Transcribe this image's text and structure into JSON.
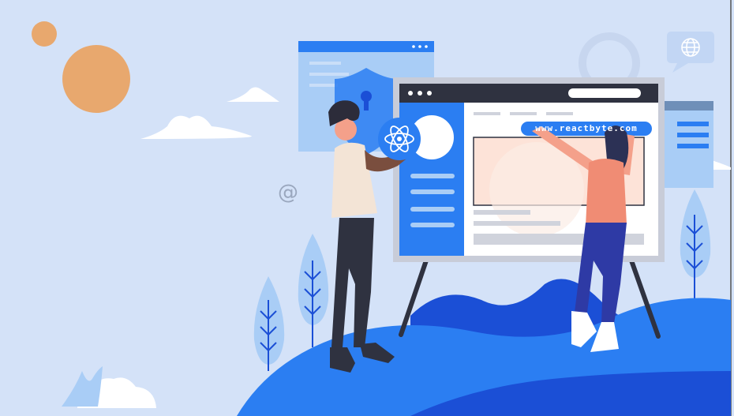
{
  "illustration": {
    "url_label": "www.reactbyte.com",
    "at_symbol": "@",
    "colors": {
      "background": "#d4e2f8",
      "primary_blue": "#2b7ef2",
      "dark_blue": "#1b4fd6",
      "light_blue": "#a9cdf6",
      "sun": "#e8a86e",
      "board_frame": "#c8ccd8",
      "board_bar": "#2f3240",
      "skin": "#f4a08a",
      "hair": "#2c3155"
    }
  }
}
